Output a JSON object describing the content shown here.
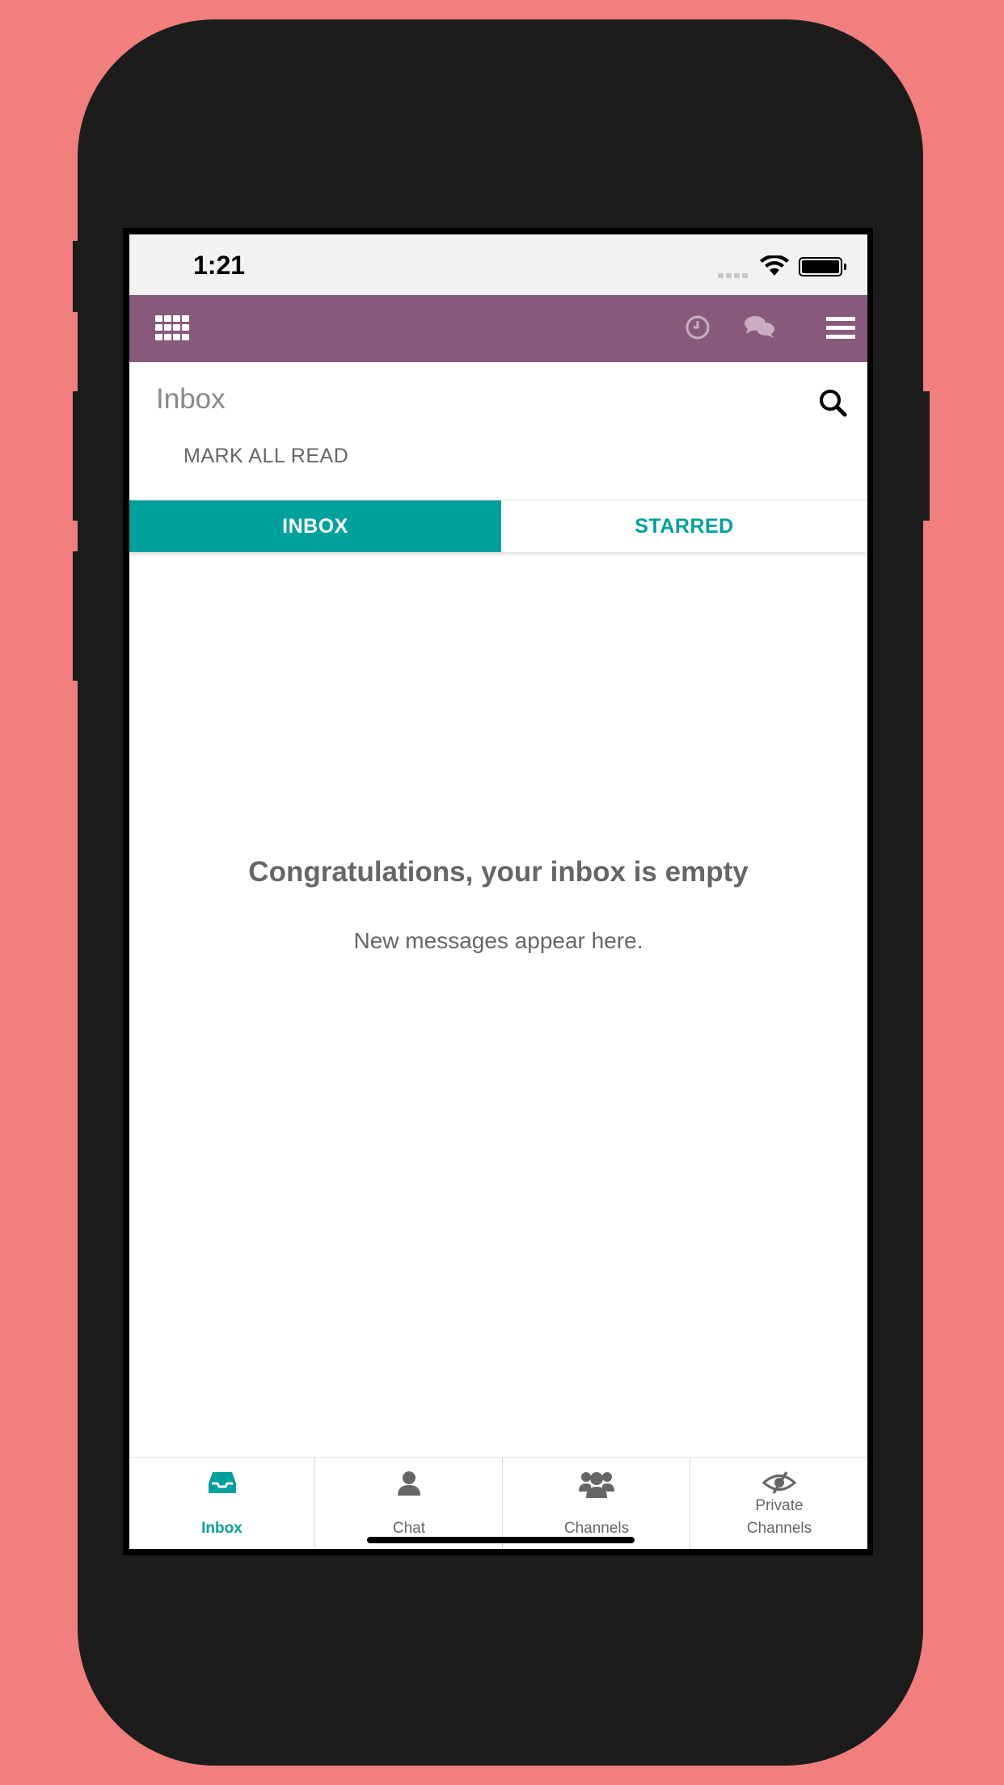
{
  "status_bar": {
    "time": "1:21"
  },
  "top_bar": {
    "icons": [
      "apps-grid-icon",
      "clock-icon",
      "chat-bubbles-icon",
      "hamburger-menu-icon"
    ],
    "color": "#875a7b"
  },
  "header": {
    "title": "Inbox",
    "mark_all_read": "MARK ALL READ"
  },
  "tabs": [
    {
      "label": "INBOX",
      "active": true
    },
    {
      "label": "STARRED",
      "active": false
    }
  ],
  "empty_state": {
    "title": "Congratulations, your inbox is empty",
    "subtitle": "New messages appear here."
  },
  "bottom_nav": [
    {
      "label": "Inbox",
      "icon": "inbox-tray-icon",
      "active": true
    },
    {
      "label": "Chat",
      "icon": "user-icon",
      "active": false
    },
    {
      "label": "Channels",
      "icon": "users-group-icon",
      "active": false
    },
    {
      "label_line1": "Private",
      "label_line2": "Channels",
      "icon": "eye-slash-icon",
      "active": false
    }
  ],
  "colors": {
    "accent": "#00a09d",
    "brand": "#875a7b",
    "background": "#f07f7d"
  }
}
